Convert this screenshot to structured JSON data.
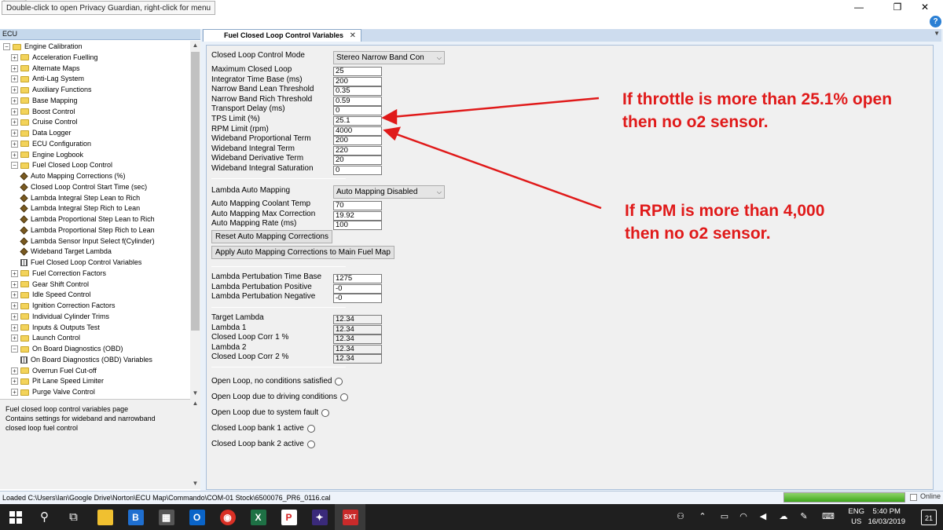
{
  "window": {
    "tooltip": "Double-click to open Privacy Guardian, right-click for menu",
    "minimize": "—",
    "maximize": "❐",
    "close": "✕",
    "help": "?"
  },
  "left": {
    "header": "ECU",
    "tree": [
      {
        "level": 0,
        "toggle": "⊟",
        "icon": "folder",
        "label": "Engine Calibration"
      },
      {
        "level": 1,
        "toggle": "⊞",
        "icon": "folder",
        "label": "Acceleration Fuelling"
      },
      {
        "level": 1,
        "toggle": "⊞",
        "icon": "folder",
        "label": "Alternate Maps"
      },
      {
        "level": 1,
        "toggle": "⊞",
        "icon": "folder",
        "label": "Anti-Lag System"
      },
      {
        "level": 1,
        "toggle": "⊞",
        "icon": "folder",
        "label": "Auxiliary Functions"
      },
      {
        "level": 1,
        "toggle": "⊞",
        "icon": "folder",
        "label": "Base Mapping"
      },
      {
        "level": 1,
        "toggle": "⊞",
        "icon": "folder",
        "label": "Boost Control"
      },
      {
        "level": 1,
        "toggle": "⊞",
        "icon": "folder",
        "label": "Cruise Control"
      },
      {
        "level": 1,
        "toggle": "⊞",
        "icon": "folder",
        "label": "Data Logger"
      },
      {
        "level": 1,
        "toggle": "⊞",
        "icon": "folder",
        "label": "ECU Configuration"
      },
      {
        "level": 1,
        "toggle": "⊞",
        "icon": "folder",
        "label": "Engine Logbook"
      },
      {
        "level": 1,
        "toggle": "⊟",
        "icon": "folder",
        "label": "Fuel Closed Loop Control"
      },
      {
        "level": 2,
        "toggle": "",
        "icon": "cube",
        "label": "Auto Mapping Corrections (%)"
      },
      {
        "level": 2,
        "toggle": "",
        "icon": "cube",
        "label": "Closed Loop Control Start Time (sec)"
      },
      {
        "level": 2,
        "toggle": "",
        "icon": "cube",
        "label": "Lambda Integral Step Lean to Rich"
      },
      {
        "level": 2,
        "toggle": "",
        "icon": "cube",
        "label": "Lambda Integral Step Rich to Lean"
      },
      {
        "level": 2,
        "toggle": "",
        "icon": "cube",
        "label": "Lambda Proportional Step Lean to Rich"
      },
      {
        "level": 2,
        "toggle": "",
        "icon": "cube",
        "label": "Lambda Proportional Step Rich to Lean"
      },
      {
        "level": 2,
        "toggle": "",
        "icon": "cube",
        "label": "Lambda Sensor Input Select f(Cylinder)"
      },
      {
        "level": 2,
        "toggle": "",
        "icon": "cube",
        "label": "Wideband Target Lambda"
      },
      {
        "level": 2,
        "toggle": "",
        "icon": "grid",
        "label": "Fuel Closed Loop Control Variables"
      },
      {
        "level": 1,
        "toggle": "⊞",
        "icon": "folder",
        "label": "Fuel Correction Factors"
      },
      {
        "level": 1,
        "toggle": "⊞",
        "icon": "folder",
        "label": "Gear Shift Control"
      },
      {
        "level": 1,
        "toggle": "⊞",
        "icon": "folder",
        "label": "Idle Speed Control"
      },
      {
        "level": 1,
        "toggle": "⊞",
        "icon": "folder",
        "label": "Ignition Correction Factors"
      },
      {
        "level": 1,
        "toggle": "⊞",
        "icon": "folder",
        "label": "Individual Cylinder Trims"
      },
      {
        "level": 1,
        "toggle": "⊞",
        "icon": "folder",
        "label": "Inputs & Outputs Test"
      },
      {
        "level": 1,
        "toggle": "⊞",
        "icon": "folder",
        "label": "Launch Control"
      },
      {
        "level": 1,
        "toggle": "⊟",
        "icon": "folder",
        "label": "On Board Diagnostics (OBD)"
      },
      {
        "level": 2,
        "toggle": "",
        "icon": "grid",
        "label": "On Board Diagnostics (OBD) Variables"
      },
      {
        "level": 1,
        "toggle": "⊞",
        "icon": "folder",
        "label": "Overrun Fuel Cut-off"
      },
      {
        "level": 1,
        "toggle": "⊞",
        "icon": "folder",
        "label": "Pit Lane Speed Limiter"
      },
      {
        "level": 1,
        "toggle": "⊞",
        "icon": "folder",
        "label": "Purge Valve Control"
      }
    ],
    "description": [
      "Fuel closed loop control variables page",
      "Contains settings for wideband and narrowband",
      "closed loop fuel control"
    ]
  },
  "tab": {
    "label": "Fuel Closed Loop Control Variables",
    "close": "✕"
  },
  "form": {
    "mode_label": "Closed Loop Control Mode",
    "mode_value": "Stereo Narrow Band Con",
    "params": [
      {
        "label": "Maximum Closed Loop",
        "value": "25"
      },
      {
        "label": "Integrator Time Base (ms)",
        "value": "200"
      },
      {
        "label": "Narrow Band Lean Threshold",
        "value": "0.35"
      },
      {
        "label": "Narrow Band Rich Threshold",
        "value": "0.59"
      },
      {
        "label": "Transport Delay (ms)",
        "value": "0"
      },
      {
        "label": "TPS Limit (%)",
        "value": "25.1"
      },
      {
        "label": "RPM Limit (rpm)",
        "value": "4000"
      },
      {
        "label": "Wideband Proportional Term",
        "value": "200"
      },
      {
        "label": "Wideband Integral Term",
        "value": "220"
      },
      {
        "label": "Wideband Derivative Term",
        "value": "20"
      },
      {
        "label": "Wideband Integral Saturation",
        "value": "0"
      }
    ],
    "auto_label": "Lambda Auto Mapping",
    "auto_value": "Auto Mapping Disabled",
    "auto_params": [
      {
        "label": "Auto Mapping Coolant Temp",
        "value": "70"
      },
      {
        "label": "Auto Mapping Max Correction",
        "value": "19.92"
      },
      {
        "label": "Auto Mapping Rate (ms)",
        "value": "100"
      }
    ],
    "reset_btn": "Reset Auto Mapping Corrections",
    "apply_btn": "Apply Auto Mapping Corrections to Main Fuel Map",
    "pert_params": [
      {
        "label": "Lambda Pertubation Time Base",
        "value": "1275"
      },
      {
        "label": "Lambda Pertubation Positive",
        "value": "-0"
      },
      {
        "label": "Lambda Pertubation Negative",
        "value": "-0"
      }
    ],
    "live_params": [
      {
        "label": "Target Lambda",
        "value": "12.34"
      },
      {
        "label": "Lambda 1",
        "value": "12.34"
      },
      {
        "label": "Closed Loop Corr 1 %",
        "value": "12.34"
      },
      {
        "label": "Lambda 2",
        "value": "12.34"
      },
      {
        "label": "Closed Loop Corr 2 %",
        "value": "12.34"
      }
    ],
    "status": [
      "Open Loop, no conditions satisfied",
      "Open Loop due to driving conditions",
      "Open Loop due to system fault",
      "Closed Loop bank 1 active",
      "Closed Loop bank 2 active"
    ]
  },
  "annotations": {
    "a1_line1": "If throttle is more than 25.1% open",
    "a1_line2": "then no o2 sensor.",
    "a2_line1": "If RPM is more than 4,000",
    "a2_line2": "then no o2 sensor.",
    "color": "#e01a1a"
  },
  "statusbar": {
    "text": "Loaded C:\\Users\\Ian\\Google Drive\\Norton\\ECU Map\\Commando\\COM-01 Stock\\6500076_PR6_0116.cal",
    "online": "Online",
    "progress": 1.0
  },
  "taskbar": {
    "lang1": "ENG",
    "lang2": "US",
    "time": "5:40 PM",
    "date": "16/03/2019",
    "notifications": "21"
  }
}
